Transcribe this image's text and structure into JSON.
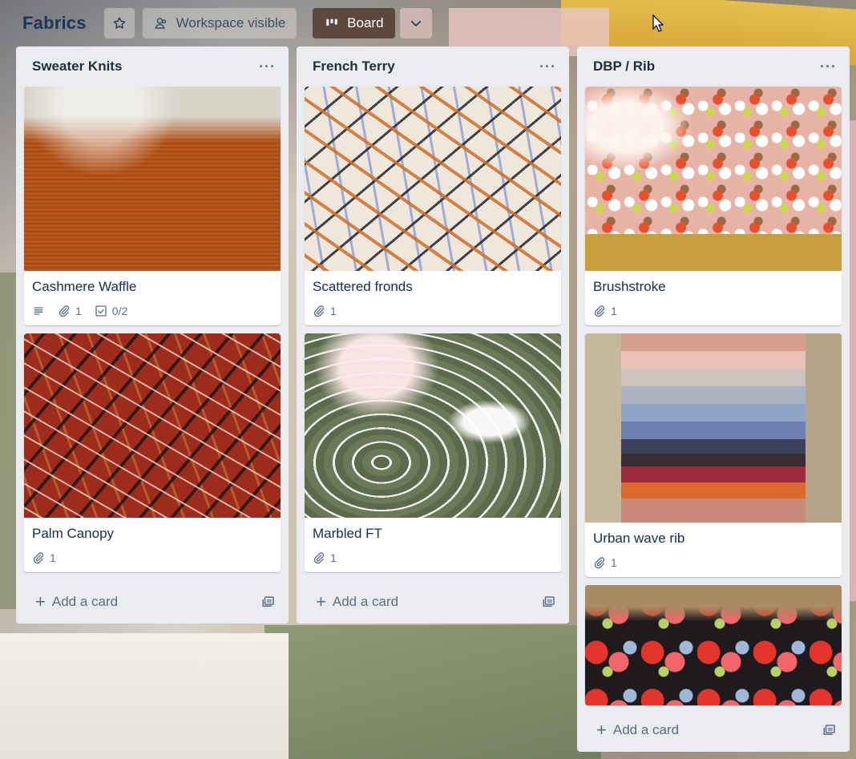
{
  "board": {
    "title": "Fabrics",
    "visibility_label": "Workspace visible",
    "view_label": "Board"
  },
  "lists": [
    {
      "title": "Sweater Knits",
      "add_card_label": "Add a card",
      "cards": [
        {
          "title": "Cashmere Waffle",
          "attachments": "1",
          "checklist": "0/2",
          "cover": "rust-waffle-knit"
        },
        {
          "title": "Palm Canopy",
          "attachments": "1",
          "cover": "red-palm-print"
        }
      ]
    },
    {
      "title": "French Terry",
      "add_card_label": "Add a card",
      "cards": [
        {
          "title": "Scattered fronds",
          "attachments": "1",
          "cover": "frond-print"
        },
        {
          "title": "Marbled FT",
          "attachments": "1",
          "cover": "green-marble"
        }
      ]
    },
    {
      "title": "DBP / Rib",
      "add_card_label": "Add a card",
      "cards": [
        {
          "title": "Brushstroke",
          "attachments": "1",
          "cover": "pink-leopard"
        },
        {
          "title": "Urban wave rib",
          "attachments": "1",
          "cover": "rib-stack"
        },
        {
          "cover": "floral-print"
        }
      ]
    }
  ],
  "icons": {
    "star": "star-icon",
    "visibility": "workspace-icon",
    "board_view": "board-icon",
    "chevron": "chevron-down-icon",
    "list_menu": "ellipsis-icon",
    "description": "description-icon",
    "attachment": "paperclip-icon",
    "checklist": "checklist-icon",
    "add": "plus-icon",
    "template": "template-icon"
  }
}
